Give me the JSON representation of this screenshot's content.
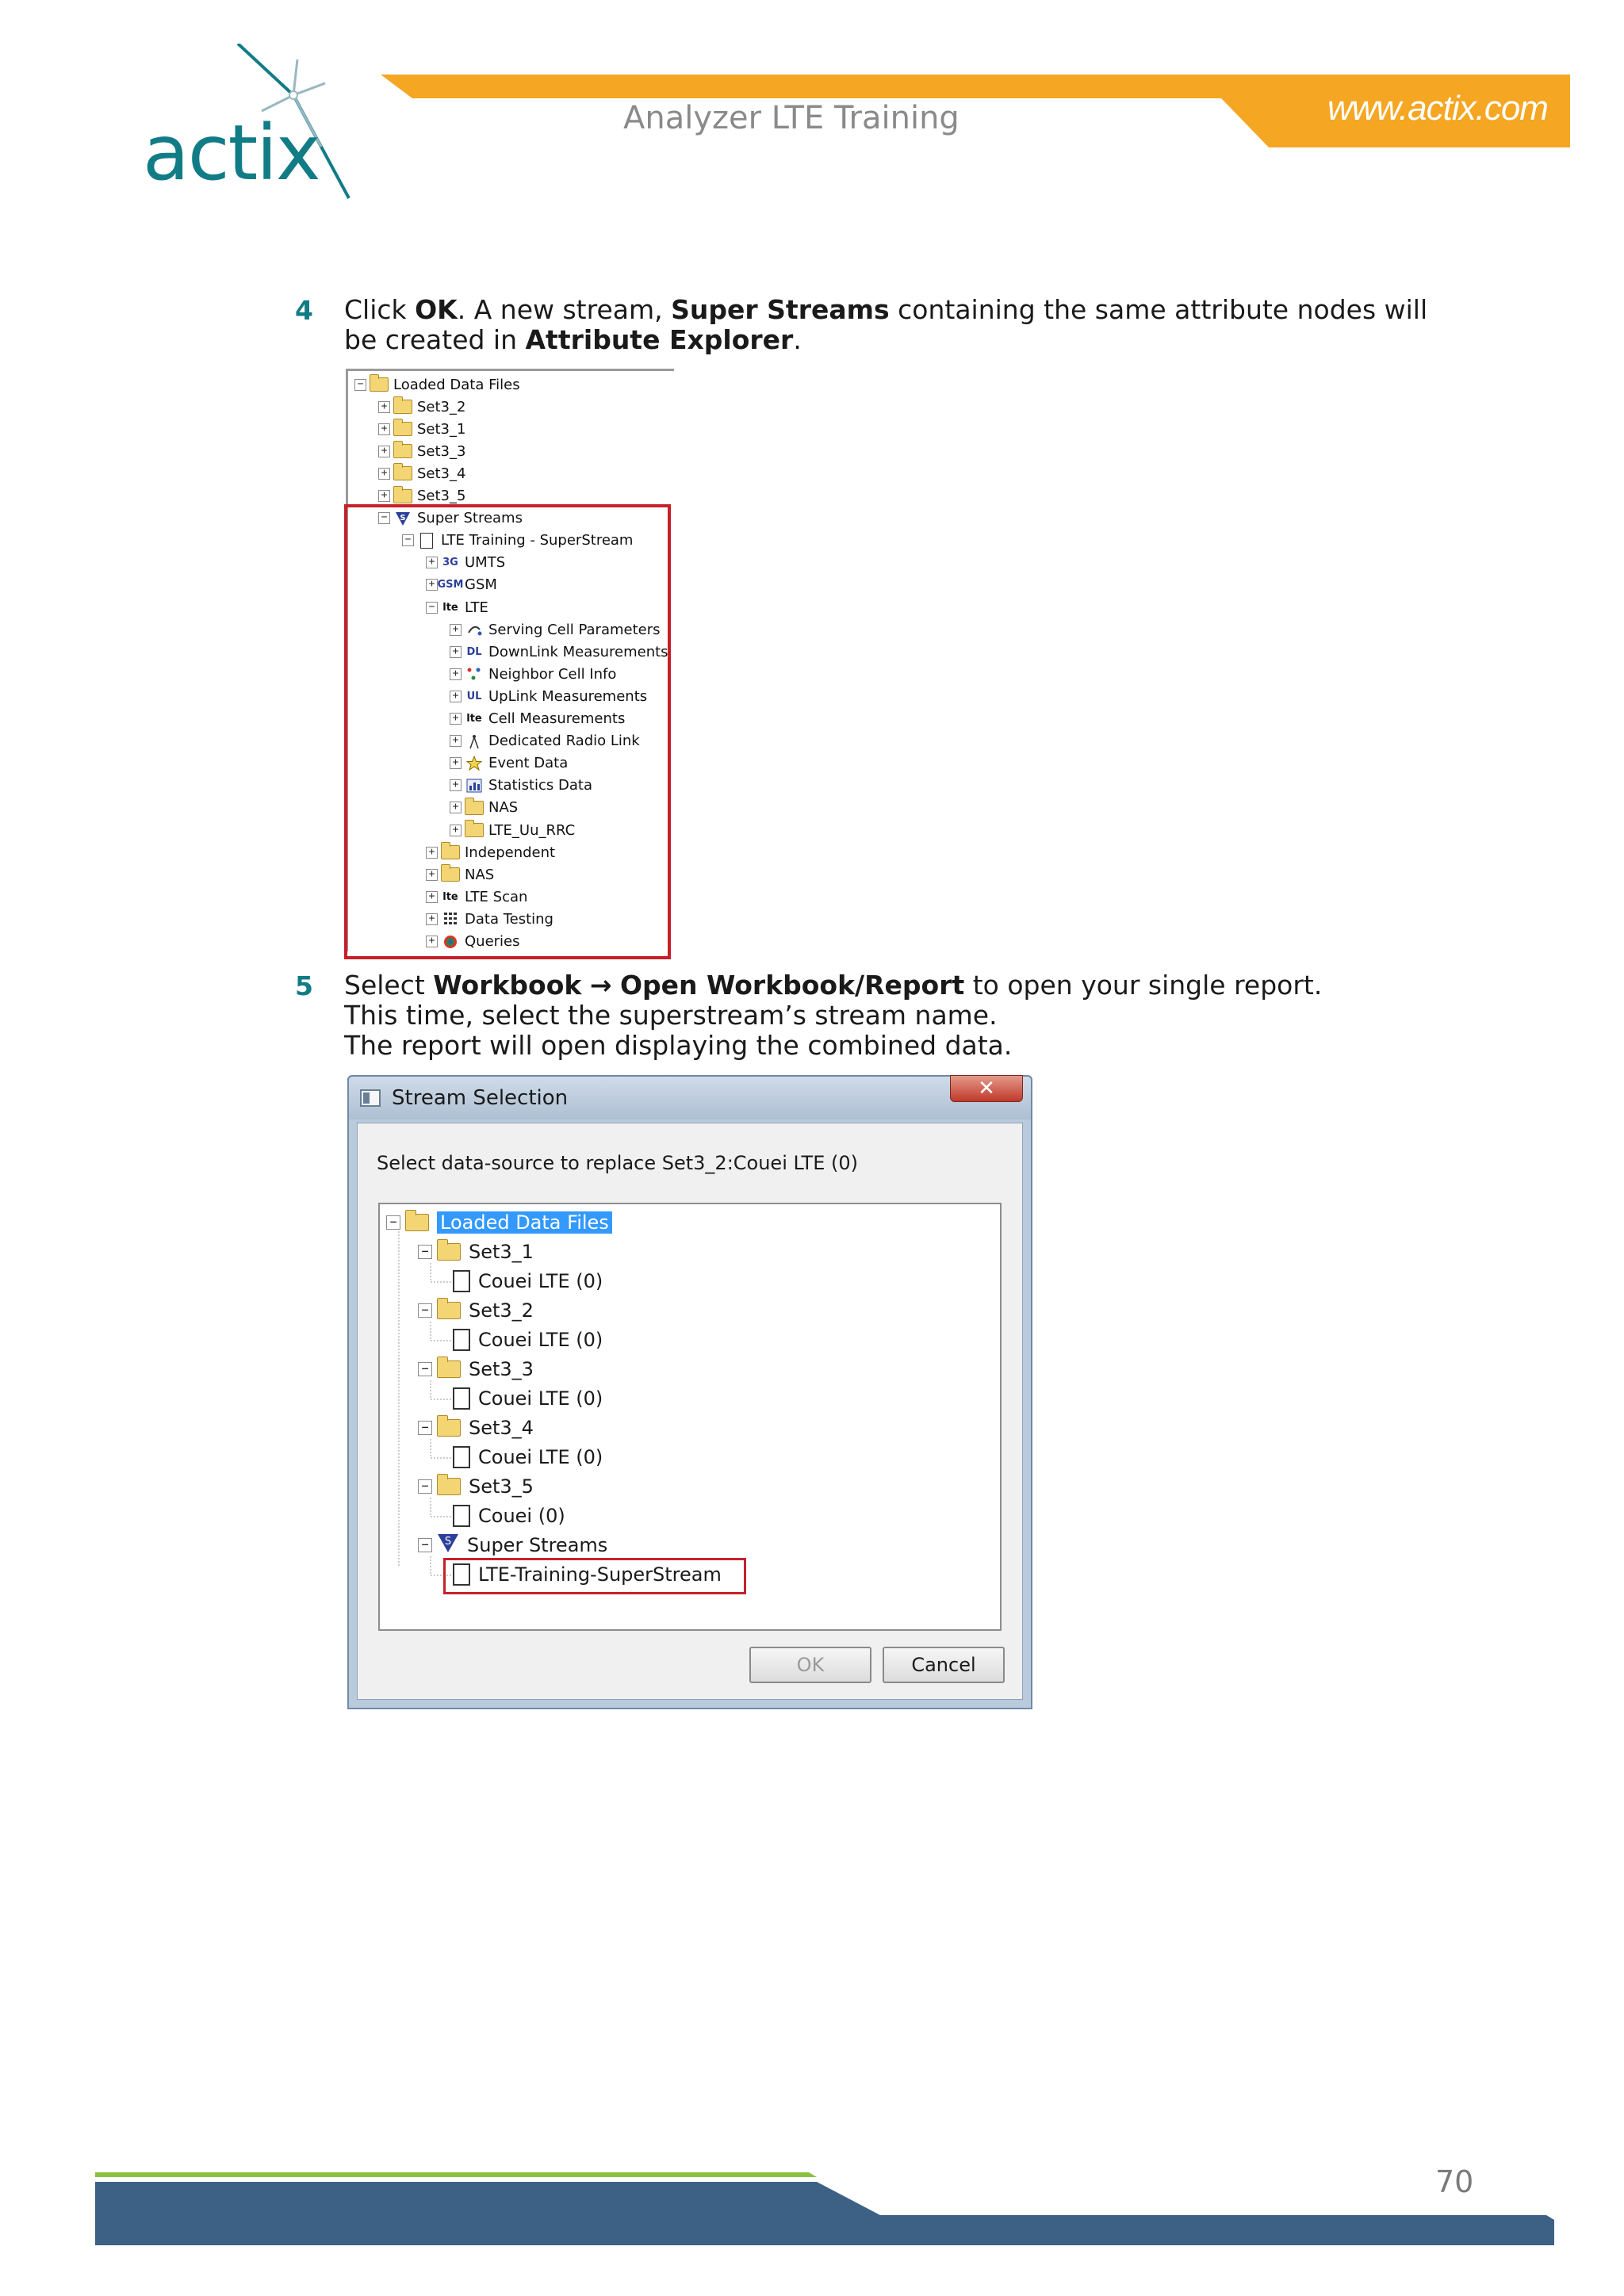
{
  "header": {
    "logo_text": "actix",
    "title": "Analyzer LTE Training",
    "url": "www.actix.com"
  },
  "step4": {
    "number": "4",
    "parts": [
      "Click ",
      "OK",
      ". A new stream, ",
      "Super Streams",
      " containing the same attribute nodes will be created in ",
      "Attribute Explorer",
      "."
    ]
  },
  "explorer": {
    "items": [
      {
        "label": "Loaded Data Files",
        "icon": "folder-icon",
        "expand": "−"
      },
      {
        "label": "Set3_2",
        "icon": "open-folder-icon",
        "expand": "+"
      },
      {
        "label": "Set3_1",
        "icon": "open-folder-icon",
        "expand": "+"
      },
      {
        "label": "Set3_3",
        "icon": "open-folder-icon",
        "expand": "+"
      },
      {
        "label": "Set3_4",
        "icon": "open-folder-icon",
        "expand": "+"
      },
      {
        "label": "Set3_5",
        "icon": "open-folder-icon",
        "expand": "+"
      },
      {
        "label": "Super Streams",
        "icon": "super-stream-icon",
        "expand": "−"
      },
      {
        "label": "LTE Training - SuperStream",
        "icon": "document-icon",
        "expand": "−"
      },
      {
        "label": "UMTS",
        "icon": "3g-icon",
        "icon_text": "3G",
        "expand": "+"
      },
      {
        "label": "GSM",
        "icon": "gsm-icon",
        "icon_text": "GSM",
        "expand": "+"
      },
      {
        "label": "LTE",
        "icon": "lte-icon",
        "icon_text": "lte",
        "expand": "−"
      },
      {
        "label": "Serving Cell Parameters",
        "icon": "serving-cell-icon",
        "expand": "+"
      },
      {
        "label": "DownLink Measurements",
        "icon": "downlink-icon",
        "icon_text": "DL",
        "expand": "+"
      },
      {
        "label": "Neighbor Cell Info",
        "icon": "neighbor-cell-icon",
        "expand": "+"
      },
      {
        "label": "UpLink Measurements",
        "icon": "uplink-icon",
        "icon_text": "UL",
        "expand": "+"
      },
      {
        "label": "Cell Measurements",
        "icon": "lte-icon",
        "icon_text": "lte",
        "expand": "+"
      },
      {
        "label": "Dedicated Radio Link",
        "icon": "radio-link-icon",
        "expand": "+"
      },
      {
        "label": "Event Data",
        "icon": "event-star-icon",
        "expand": "+"
      },
      {
        "label": "Statistics Data",
        "icon": "statistics-icon",
        "expand": "+"
      },
      {
        "label": "NAS",
        "icon": "folder-icon",
        "expand": "+"
      },
      {
        "label": "LTE_Uu_RRC",
        "icon": "folder-icon",
        "expand": "+"
      },
      {
        "label": "Independent",
        "icon": "folder-icon",
        "expand": "+"
      },
      {
        "label": "NAS",
        "icon": "folder-icon",
        "expand": "+"
      },
      {
        "label": "LTE Scan",
        "icon": "lte-icon",
        "icon_text": "lte",
        "expand": "+"
      },
      {
        "label": "Data Testing",
        "icon": "data-testing-icon",
        "expand": "+"
      },
      {
        "label": "Queries",
        "icon": "queries-icon",
        "expand": "+"
      }
    ]
  },
  "step5": {
    "number": "5",
    "parts": [
      "Select ",
      "Workbook",
      " ",
      "→",
      " ",
      "Open Workbook/Report",
      " to open your single report."
    ],
    "line2": "This time, select the superstream’s stream name.",
    "line3": "The report will open displaying the combined data."
  },
  "dialog": {
    "title": "Stream Selection",
    "close": "✕",
    "prompt": "Select data-source to replace Set3_2:Couei LTE (0)",
    "tree": [
      {
        "label": "Loaded Data Files",
        "type": "folder",
        "expand": "−",
        "selected": true
      },
      {
        "label": "Set3_1",
        "type": "folder",
        "expand": "−"
      },
      {
        "label": "Couei LTE (0)",
        "type": "doc"
      },
      {
        "label": "Set3_2",
        "type": "folder",
        "expand": "−"
      },
      {
        "label": "Couei LTE (0)",
        "type": "doc"
      },
      {
        "label": "Set3_3",
        "type": "folder",
        "expand": "−"
      },
      {
        "label": "Couei LTE (0)",
        "type": "doc"
      },
      {
        "label": "Set3_4",
        "type": "folder",
        "expand": "−"
      },
      {
        "label": "Couei LTE (0)",
        "type": "doc"
      },
      {
        "label": "Set3_5",
        "type": "folder",
        "expand": "−"
      },
      {
        "label": "Couei (0)",
        "type": "doc"
      },
      {
        "label": "Super Streams",
        "type": "super",
        "expand": "−"
      },
      {
        "label": "LTE-Training-SuperStream",
        "type": "doc",
        "highlighted": true
      }
    ],
    "ok_label": "OK",
    "cancel_label": "Cancel"
  },
  "footer": {
    "page_number": "70"
  },
  "colors": {
    "brand_teal": "#127c86",
    "header_orange": "#f5a623",
    "footer_blue": "#3d6185",
    "footer_green": "#8bbf3f",
    "highlight_red": "#c8202a"
  }
}
